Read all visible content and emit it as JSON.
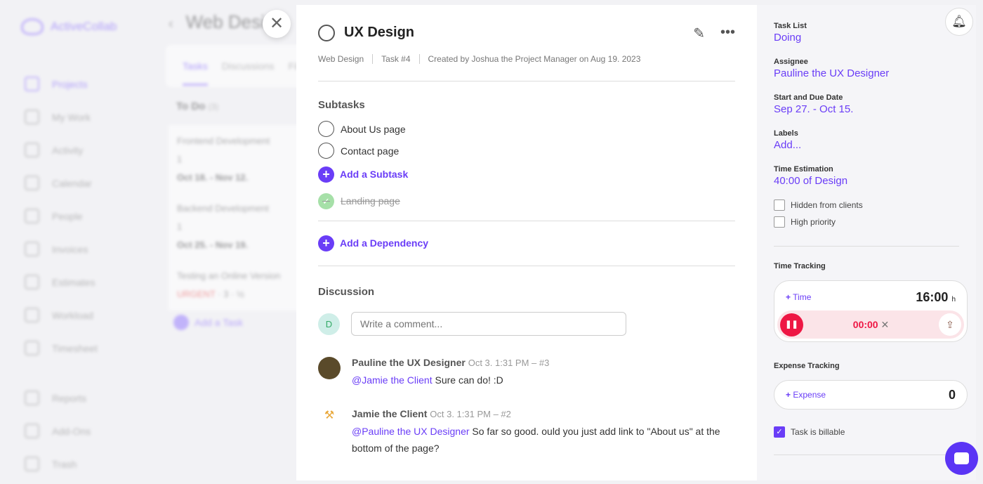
{
  "app": {
    "name": "ActiveCollab"
  },
  "nav": [
    "Projects",
    "My Work",
    "Activity",
    "Calendar",
    "People",
    "Invoices",
    "Estimates",
    "Workload",
    "Timesheet",
    "Reports",
    "Add-Ons",
    "Trash"
  ],
  "project": {
    "title": "Web Design",
    "tabs": [
      "Tasks",
      "Discussions",
      "Files"
    ],
    "list_title": "To Do",
    "list_count": "(3)",
    "cards": [
      {
        "title": "Frontend Development",
        "meta": "1",
        "dates": "Oct 18. - Nov 12."
      },
      {
        "title": "Backend Development",
        "meta": "1",
        "dates": "Oct 25. - Nov 19."
      },
      {
        "title": "Testing an Online Version",
        "label": "URGENT",
        "meta": "3 · ½"
      }
    ],
    "add_task": "Add a Task"
  },
  "task": {
    "title": "UX Design",
    "meta": [
      "Web Design",
      "Task #4",
      "Created by Joshua the Project Manager on Aug 19. 2023"
    ],
    "subtasks_title": "Subtasks",
    "subtasks": [
      "About Us page",
      "Contact page"
    ],
    "add_subtask": "Add a Subtask",
    "completed_subtask": "Landing page",
    "add_dependency": "Add a Dependency",
    "discussion_title": "Discussion",
    "my_initial": "D",
    "comment_placeholder": "Write a comment...",
    "comments": [
      {
        "author": "Pauline the UX Designer",
        "when": "Oct 3. 1:31 PM – #3",
        "mention": "@Jamie the Client",
        "text": " Sure can do! :D"
      },
      {
        "author": "Jamie the Client",
        "when": "Oct 3. 1:31 PM – #2",
        "mention": "@Pauline the UX Designer",
        "text": " So far so good. ould you just add link to \"About us\" at the bottom of the page?"
      }
    ]
  },
  "sidebar": {
    "task_list_label": "Task List",
    "task_list": "Doing",
    "assignee_label": "Assignee",
    "assignee": "Pauline the UX Designer",
    "dates_label": "Start and Due Date",
    "dates": "Sep 27. - Oct 15.",
    "labels_label": "Labels",
    "labels": "Add...",
    "estimation_label": "Time Estimation",
    "estimation": "40:00 of Design",
    "hidden_from_clients": "Hidden from clients",
    "high_priority": "High priority",
    "time_tracking_label": "Time Tracking",
    "add_time": "Time",
    "time_total": "16:00",
    "time_unit": "h",
    "timer": "00:00",
    "expense_tracking_label": "Expense Tracking",
    "add_expense": "Expense",
    "expense_total": "0",
    "billable": "Task is billable"
  },
  "colors": {
    "accent": "#6a3df7",
    "timer": "#ee1744"
  }
}
